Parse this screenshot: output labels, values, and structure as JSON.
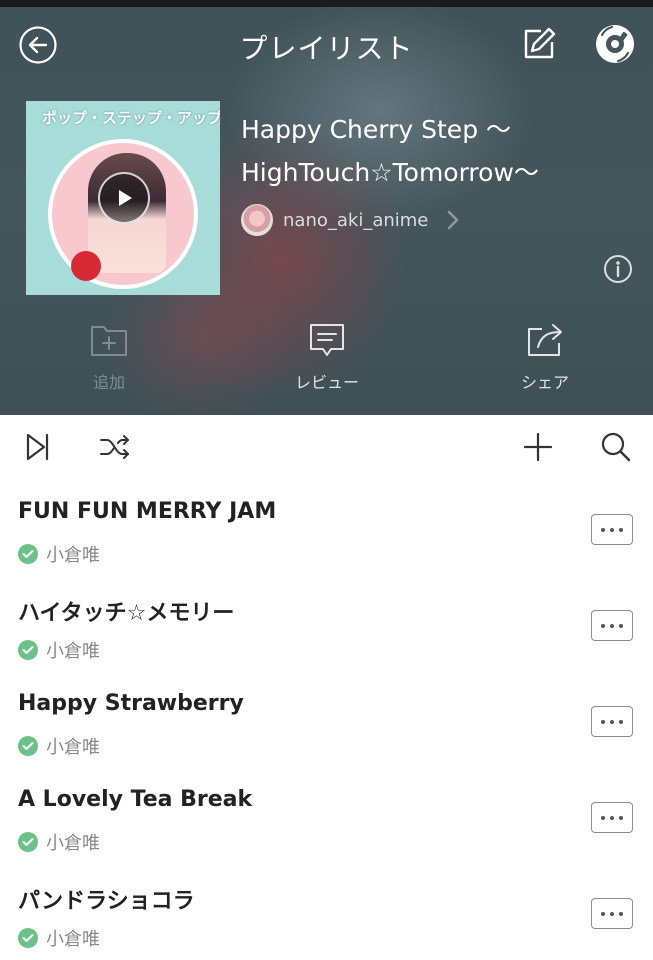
{
  "header": {
    "title": "プレイリスト",
    "cover_banner": "ポップ・ステップ・アップル",
    "playlist_name_line1": "Happy Cherry Step 〜",
    "playlist_name_line2": "HighTouch☆Tomorrow〜",
    "owner": "nano_aki_anime",
    "actions": [
      {
        "label": "追加",
        "icon": "add-folder-icon"
      },
      {
        "label": "レビュー",
        "icon": "comment-icon"
      },
      {
        "label": "シェア",
        "icon": "share-icon"
      }
    ]
  },
  "colors": {
    "header_bg": "#44565b",
    "check_green": "#6dc18b",
    "action_disabled": "#7f8c8f",
    "action_enabled": "#e1e6e7"
  },
  "tracks": [
    {
      "title": "FUN FUN MERRY JAM",
      "artist": "小倉唯"
    },
    {
      "title": "ハイタッチ☆メモリー",
      "artist": "小倉唯"
    },
    {
      "title": "Happy Strawberry",
      "artist": "小倉唯"
    },
    {
      "title": "A Lovely Tea Break",
      "artist": "小倉唯"
    },
    {
      "title": "パンドラショコラ",
      "artist": "小倉唯"
    }
  ]
}
